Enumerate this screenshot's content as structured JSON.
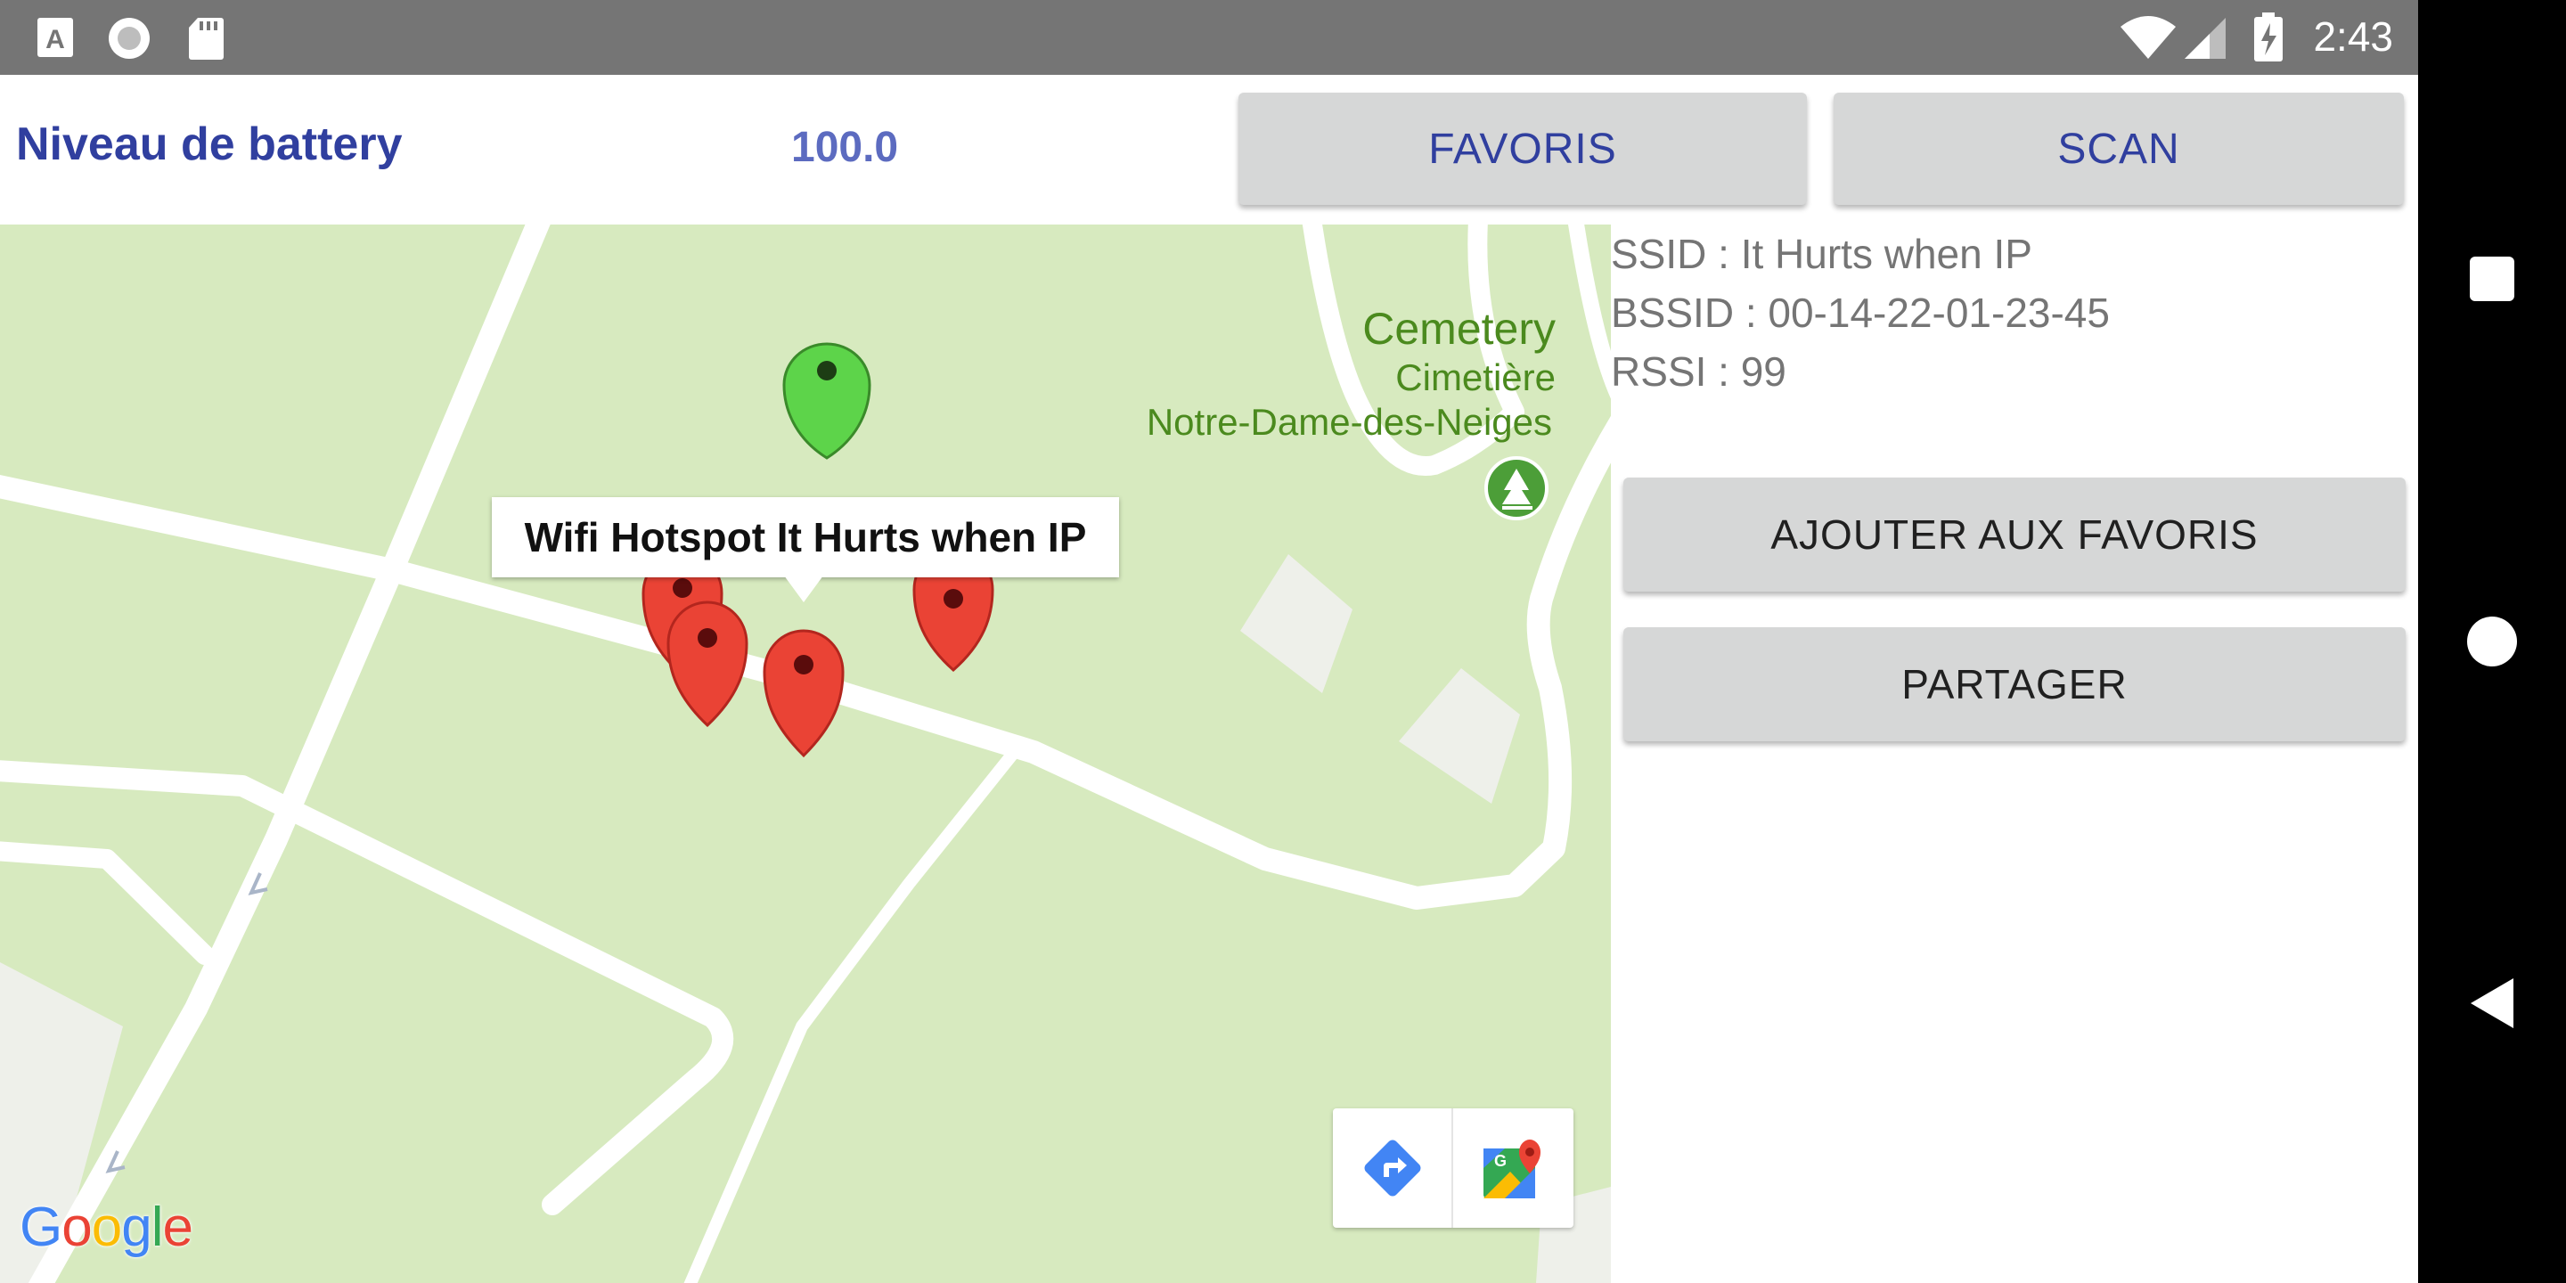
{
  "status_bar": {
    "time": "2:43",
    "left_icons": [
      "font-notification-icon",
      "record-icon",
      "sd-card-icon"
    ],
    "right_icons": [
      "wifi-icon",
      "signal-icon",
      "battery-charging-icon"
    ]
  },
  "header": {
    "battery_label": "Niveau de battery",
    "battery_value": "100.0",
    "favoris_label": "FAVORIS",
    "scan_label": "SCAN"
  },
  "map": {
    "labels": {
      "cemetery": "Cemetery",
      "cimetiere": "Cimetière",
      "notre_dame": "Notre-Dame-des-Neiges"
    },
    "info_window_text": "Wifi Hotspot It Hurts when IP",
    "google_logo": [
      "G",
      "o",
      "o",
      "g",
      "l",
      "e"
    ],
    "colors": {
      "land": "#d7eabf",
      "road": "#ffffff",
      "marker_red": "#ea4335",
      "marker_green": "#5dd44a",
      "label_green": "#4b8a1e"
    }
  },
  "wifi": {
    "ssid": "SSID : It Hurts when IP",
    "bssid": "BSSID : 00-14-22-01-23-45",
    "rssi": "RSSI : 99"
  },
  "actions": {
    "add_favoris_label": "AJOUTER AUX FAVORIS",
    "partager_label": "PARTAGER"
  },
  "theme": {
    "accent": "#303f9f",
    "button_bg": "#d6d7d7",
    "status_bar_bg": "#757575"
  }
}
